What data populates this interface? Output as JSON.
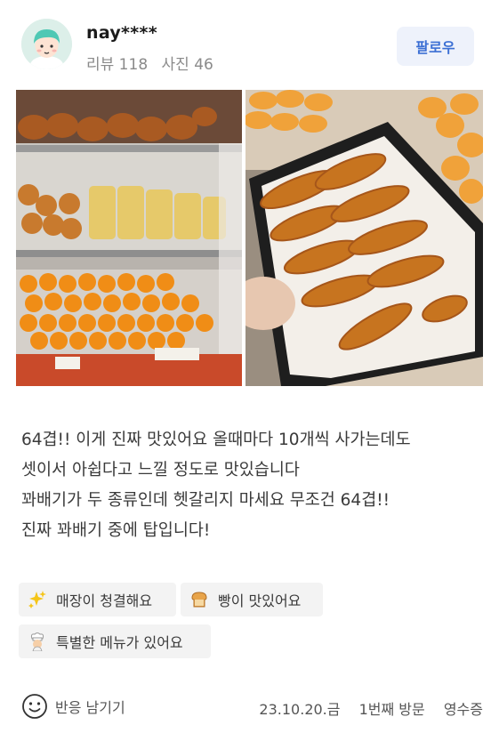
{
  "user": {
    "name": "nay****",
    "review_count_text": "리뷰 118",
    "photo_count_text": "사진 46",
    "follow_label": "팔로우"
  },
  "photos": [
    {
      "icon": "bakery-display-photo"
    },
    {
      "icon": "twisted-donuts-tray-photo"
    }
  ],
  "review": {
    "lines": [
      "64겹!! 이게 진짜 맛있어요 올때마다 10개씩 사가는데도",
      "셋이서 아쉽다고 느낄 정도로 맛있습니다",
      "꽈배기가 두 종류인데 헷갈리지 마세요 무조건 64겹!!",
      "진짜 꽈배기 중에 탑입니다!"
    ]
  },
  "keywords": [
    {
      "icon": "sparkles-icon",
      "label": "매장이 청결해요"
    },
    {
      "icon": "bread-icon",
      "label": "빵이 맛있어요"
    },
    {
      "icon": "chef-icon",
      "label": "특별한 메뉴가 있어요"
    }
  ],
  "footer": {
    "react_label": "반응 남기기",
    "date": "23.10.20.금",
    "visit": "1번째 방문",
    "verification": "영수증"
  },
  "colors": {
    "accent": "#3b6fd4",
    "follow_bg": "#eef2fb",
    "chip_bg": "#f3f3f3",
    "muted": "#8a8a8a"
  }
}
